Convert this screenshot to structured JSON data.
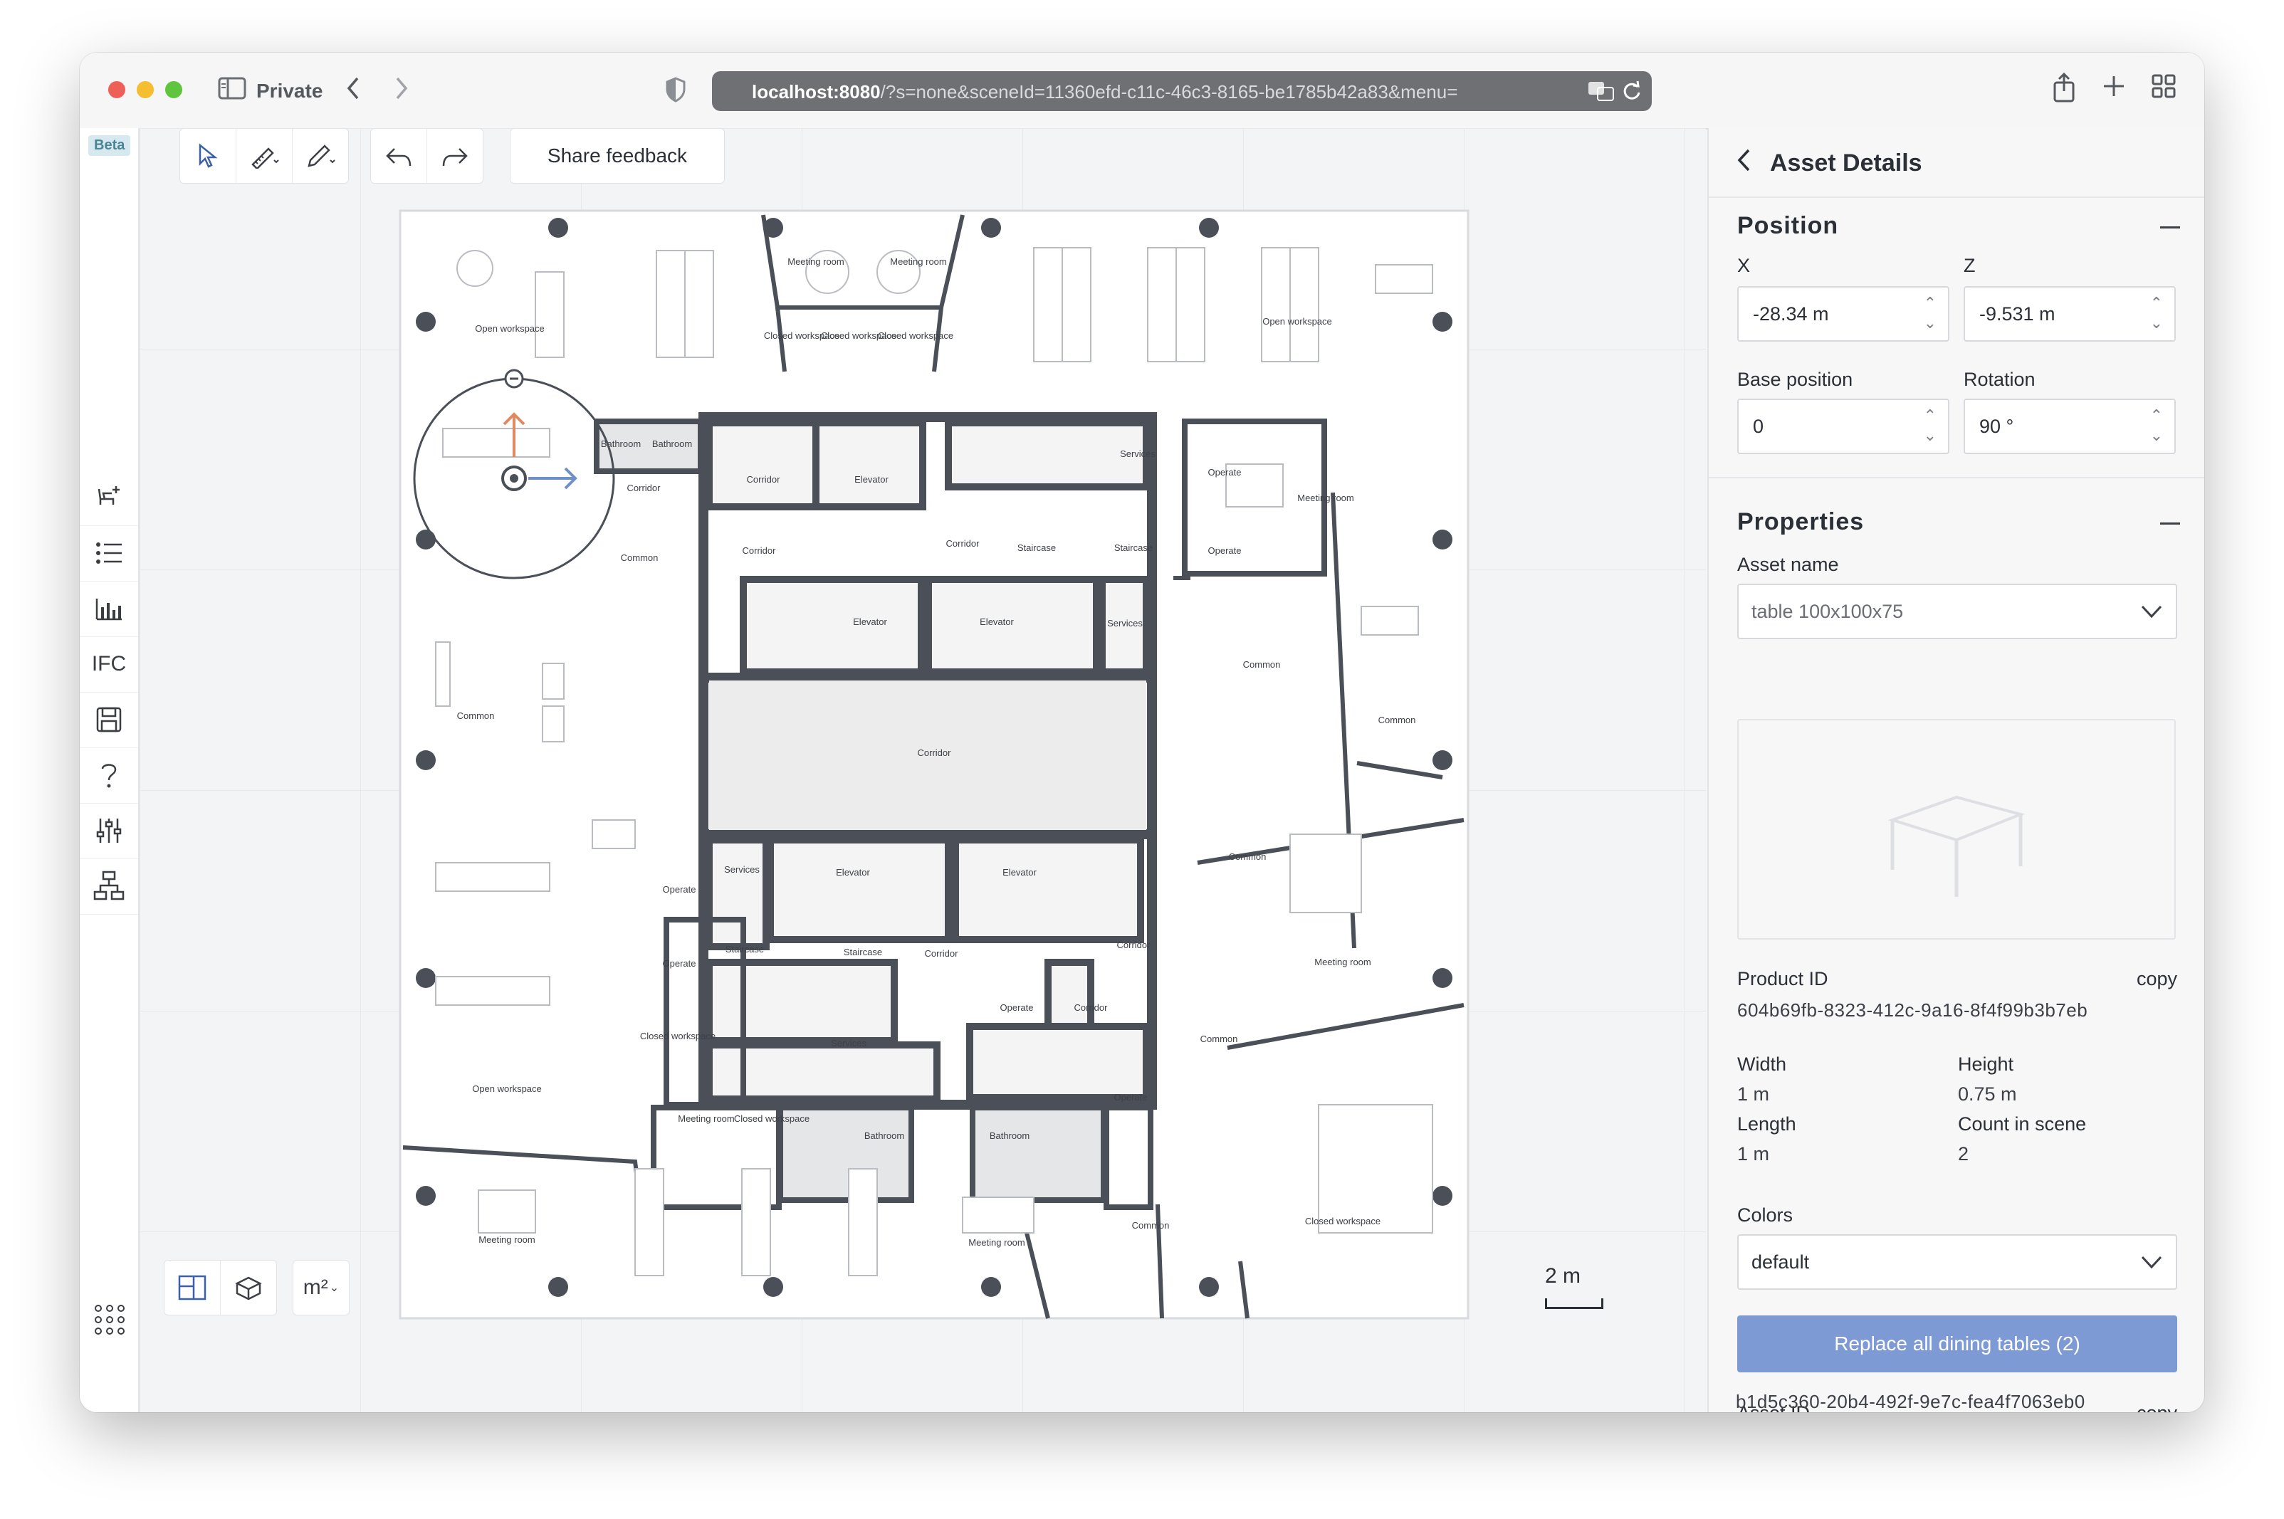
{
  "browser": {
    "mode_label": "Private",
    "url_host": "localhost:8080",
    "url_path": "/?s=none&sceneId=11360efd-c11c-46c3-8165-be1785b42a83&menu="
  },
  "sidebar": {
    "beta_badge": "Beta",
    "ifc_label": "IFC"
  },
  "toolbar": {
    "feedback_label": "Share feedback"
  },
  "floorplan": {
    "rooms": [
      "Open workspace",
      "Meeting room",
      "Meeting room",
      "Closed workspace",
      "Closed workspace",
      "Closed workspace",
      "Open workspace",
      "Bathroom",
      "Bathroom",
      "Corridor",
      "Corridor",
      "Elevator",
      "Services",
      "Operate",
      "Meeting room",
      "Corridor",
      "Corridor",
      "Staircase",
      "Staircase",
      "Operate",
      "Common",
      "Elevator",
      "Elevator",
      "Services",
      "Common",
      "Common",
      "Corridor",
      "Common",
      "Services",
      "Elevator",
      "Elevator",
      "Common",
      "Operate",
      "Staircase",
      "Staircase",
      "Corridor",
      "Corridor",
      "Meeting room",
      "Operate",
      "Operate",
      "Corridor",
      "Closed workspace",
      "Services",
      "Common",
      "Open workspace",
      "Meeting room",
      "Closed workspace",
      "Bathroom",
      "Bathroom",
      "Operate",
      "Meeting room",
      "Meeting room",
      "Common",
      "Closed workspace"
    ]
  },
  "bottom": {
    "unit_label": "m²",
    "scale_label": "2 m"
  },
  "panel": {
    "title": "Asset Details",
    "position_title": "Position",
    "x_label": "X",
    "z_label": "Z",
    "x_value": "-28.34 m",
    "z_value": "-9.531 m",
    "base_label": "Base position",
    "rotation_label": "Rotation",
    "base_value": "0",
    "rotation_value": "90 °",
    "properties_title": "Properties",
    "asset_name_label": "Asset name",
    "asset_name_value": "table 100x100x75",
    "product_id_label": "Product ID",
    "copy_label": "copy",
    "product_id": "604b69fb-8323-412c-9a16-8f4f99b3b7eb",
    "width_label": "Width",
    "width_value": "1 m",
    "height_label": "Height",
    "height_value": "0.75 m",
    "length_label": "Length",
    "length_value": "1 m",
    "count_label": "Count in scene",
    "count_value": "2",
    "colors_label": "Colors",
    "colors_value": "default",
    "replace_button": "Replace all dining tables (2)",
    "asset_id_label": "Asset ID",
    "asset_id": "b1d5c360-20b4-492f-9e7c-fea4f7063eb0"
  }
}
